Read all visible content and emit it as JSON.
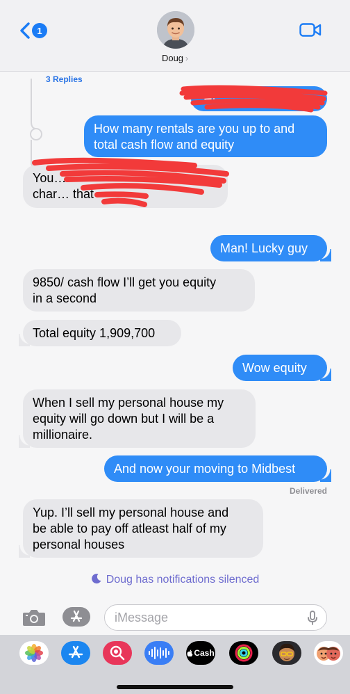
{
  "header": {
    "back_badge": "1",
    "contact_name": "Doug",
    "contact_chevron": "›"
  },
  "thread": {
    "replies_label": "3 Replies"
  },
  "messages": [
    {
      "from": "me",
      "text": "Hi…"
    },
    {
      "from": "me",
      "lines": [
        "How many rentals are you up to and",
        "total cash flow and equity"
      ]
    },
    {
      "from": "them",
      "lines": [
        "You…",
        "char…  that"
      ]
    },
    {
      "from": "me",
      "text": "Man! Lucky guy"
    },
    {
      "from": "them",
      "lines": [
        "9850/ cash flow I’ll get you equity",
        "in a second"
      ]
    },
    {
      "from": "them",
      "text": "Total equity 1,909,700"
    },
    {
      "from": "me",
      "text": "Wow equity"
    },
    {
      "from": "them",
      "lines": [
        "When I sell my personal house my",
        "equity will go down but I will be a",
        "millionaire."
      ]
    },
    {
      "from": "me",
      "text": "And now your moving to Midbest"
    },
    {
      "from": "them",
      "lines": [
        "Yup. I’ll sell my personal house and",
        "be able to pay off atleast half of my",
        "personal houses"
      ]
    }
  ],
  "delivered_label": "Delivered",
  "silenced_notice": "Doug has notifications silenced",
  "composer": {
    "placeholder": "iMessage"
  },
  "drawer_apps": [
    {
      "name": "photos-app-icon"
    },
    {
      "name": "app-store-icon"
    },
    {
      "name": "search-images-icon"
    },
    {
      "name": "audio-message-icon"
    },
    {
      "name": "apple-cash-icon",
      "label": "Cash"
    },
    {
      "name": "activity-icon"
    },
    {
      "name": "memoji-icon"
    },
    {
      "name": "memoji-stickers-icon"
    }
  ],
  "colors": {
    "outgoing_bubble": "#2f8cf7",
    "incoming_bubble": "#e7e7ea",
    "accent": "#1b7cf5",
    "redaction": "#f23a3a"
  }
}
